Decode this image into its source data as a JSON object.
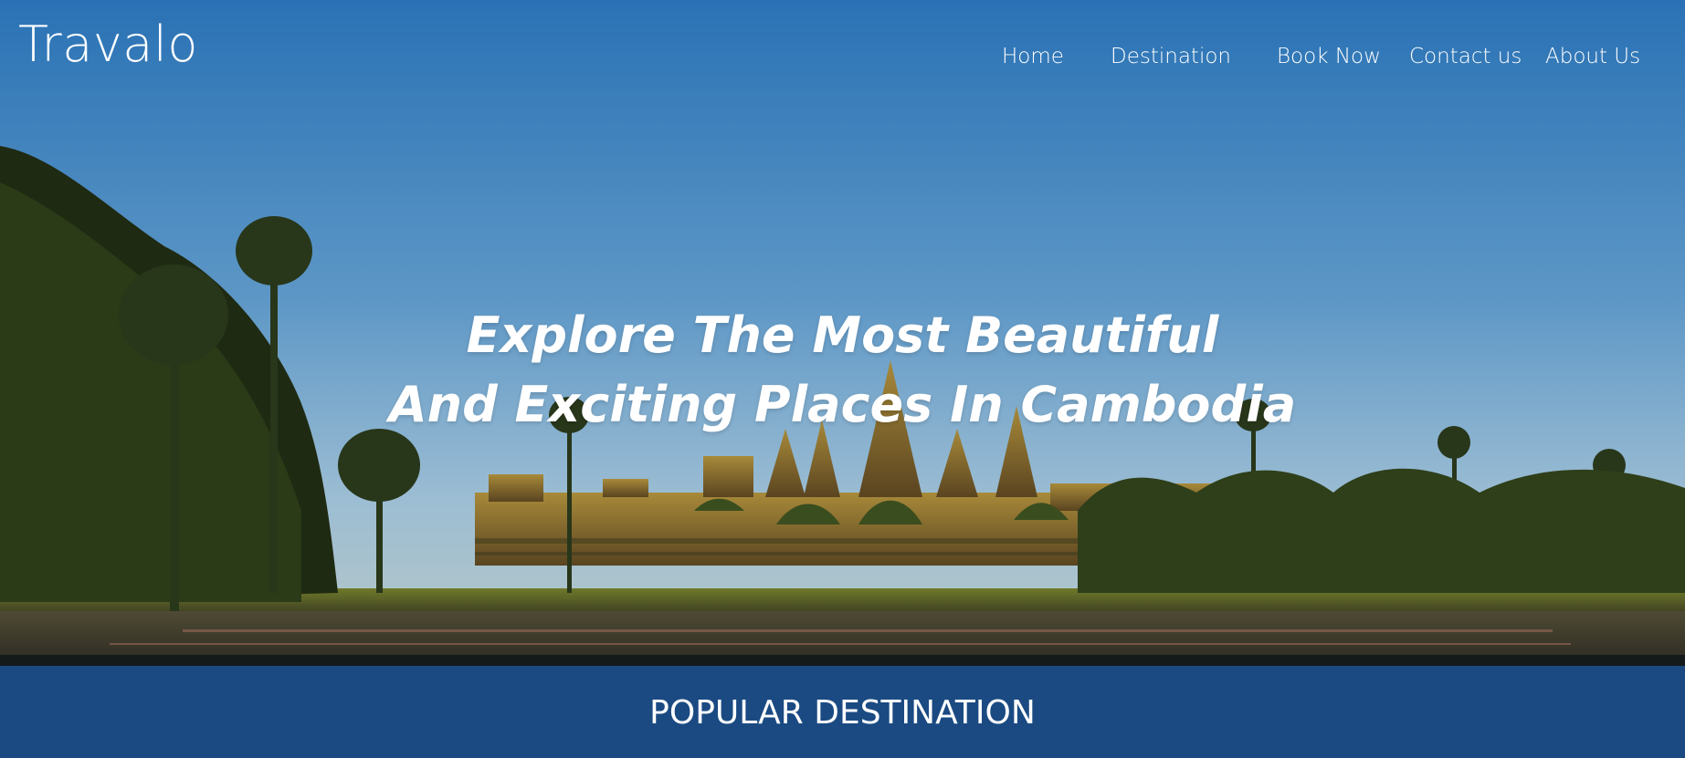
{
  "brand": {
    "name": "Travalo"
  },
  "nav": {
    "items": [
      {
        "label": "Home"
      },
      {
        "label": "Destination"
      },
      {
        "label": "Book Now"
      },
      {
        "label": "Contact us"
      },
      {
        "label": "About Us"
      }
    ]
  },
  "hero": {
    "line1": "Explore The Most Beautiful",
    "line2": "And Exciting Places In Cambodia"
  },
  "section": {
    "title": "POPULAR DESTINATION"
  },
  "colors": {
    "sky_top": "#1e6fb8",
    "sky_bottom": "#8fb6d4",
    "band": "#1b4a82",
    "text": "#ffffff"
  }
}
